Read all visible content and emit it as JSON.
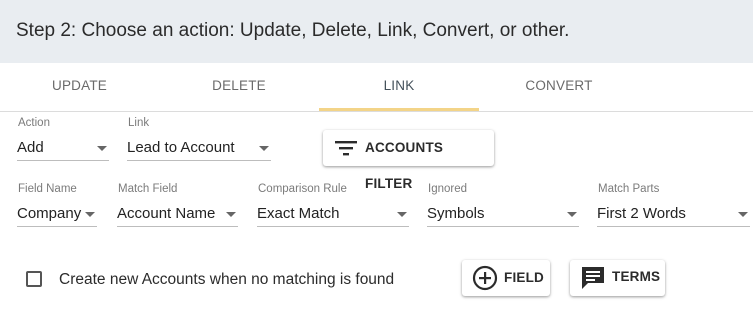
{
  "header": {
    "title": "Step 2: Choose an action: Update, Delete, Link, Convert, or other."
  },
  "tabs": [
    {
      "label": "UPDATE",
      "active": false
    },
    {
      "label": "DELETE",
      "active": false
    },
    {
      "label": "LINK",
      "active": true
    },
    {
      "label": "CONVERT",
      "active": false
    }
  ],
  "accent_color": "#f3d488",
  "row1": {
    "action": {
      "label": "Action",
      "value": "Add"
    },
    "link": {
      "label": "Link",
      "value": "Lead to Account"
    },
    "filter_button": {
      "label": "ACCOUNTS FILTER",
      "icon": "filter-icon"
    }
  },
  "row2": {
    "field_name": {
      "label": "Field Name",
      "value": "Company"
    },
    "match_field": {
      "label": "Match Field",
      "value": "Account Name"
    },
    "comparison_rule": {
      "label": "Comparison Rule",
      "value": "Exact Match"
    },
    "ignored": {
      "label": "Ignored",
      "value": "Symbols"
    },
    "match_parts": {
      "label": "Match Parts",
      "value": "First 2 Words"
    }
  },
  "footer": {
    "checkbox_label": "Create new Accounts when no matching is found",
    "checkbox_checked": false,
    "field_button": {
      "label": "FIELD",
      "icon": "add-circle-icon"
    },
    "terms_button": {
      "label": "TERMS",
      "icon": "message-icon"
    }
  }
}
